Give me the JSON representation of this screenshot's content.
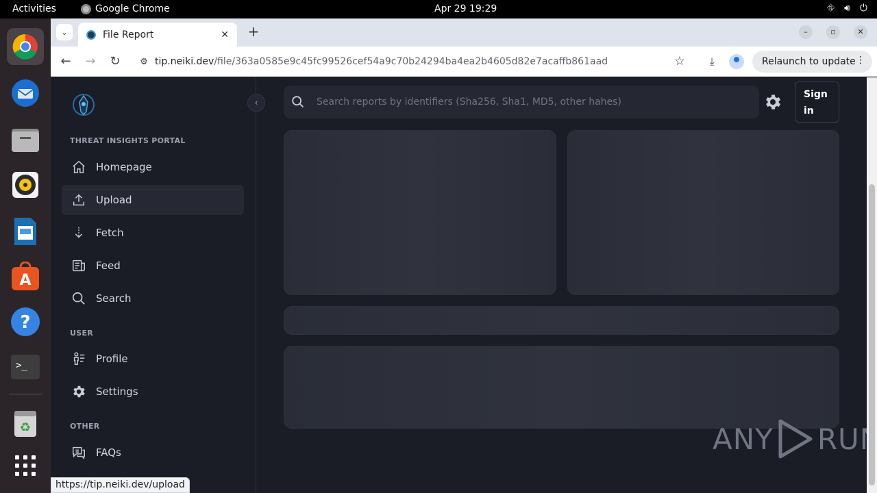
{
  "system": {
    "activities": "Activities",
    "app_name": "Google Chrome",
    "clock": "Apr 29  19:29"
  },
  "dock": {
    "items": [
      "chrome",
      "thunderbird",
      "files",
      "rhythmbox",
      "libreoffice-writer",
      "app-center",
      "help",
      "terminal",
      "trash",
      "show-apps"
    ]
  },
  "browser": {
    "tab_title": "File Report",
    "url_host": "tip.neiki.dev",
    "url_path": "/file/363a0585e9c45fc99526cef54a9c70b24294ba4ea2b4605d82e7acaffb861aad",
    "relaunch_label": "Relaunch to update",
    "status_url": "https://tip.neiki.dev/upload"
  },
  "sidebar": {
    "sections": {
      "portal": "THREAT INSIGHTS PORTAL",
      "user": "USER",
      "other": "OTHER"
    },
    "items": [
      {
        "label": "Homepage",
        "icon": "home-icon"
      },
      {
        "label": "Upload",
        "icon": "upload-icon"
      },
      {
        "label": "Fetch",
        "icon": "fetch-icon"
      },
      {
        "label": "Feed",
        "icon": "feed-icon"
      },
      {
        "label": "Search",
        "icon": "search-icon"
      },
      {
        "label": "Profile",
        "icon": "profile-icon"
      },
      {
        "label": "Settings",
        "icon": "gear-icon"
      },
      {
        "label": "FAQs",
        "icon": "faq-icon"
      }
    ]
  },
  "header": {
    "search_placeholder": "Search reports by identifiers (Sha256, Sha1, MD5, other hahes)",
    "signin_line1": "Sign",
    "signin_line2": "in"
  },
  "watermark": {
    "left": "ANY",
    "right": "RUN"
  },
  "colors": {
    "page_bg": "#1b1d26",
    "skeleton": "#2a2d37",
    "accent": "#1a73e8"
  }
}
